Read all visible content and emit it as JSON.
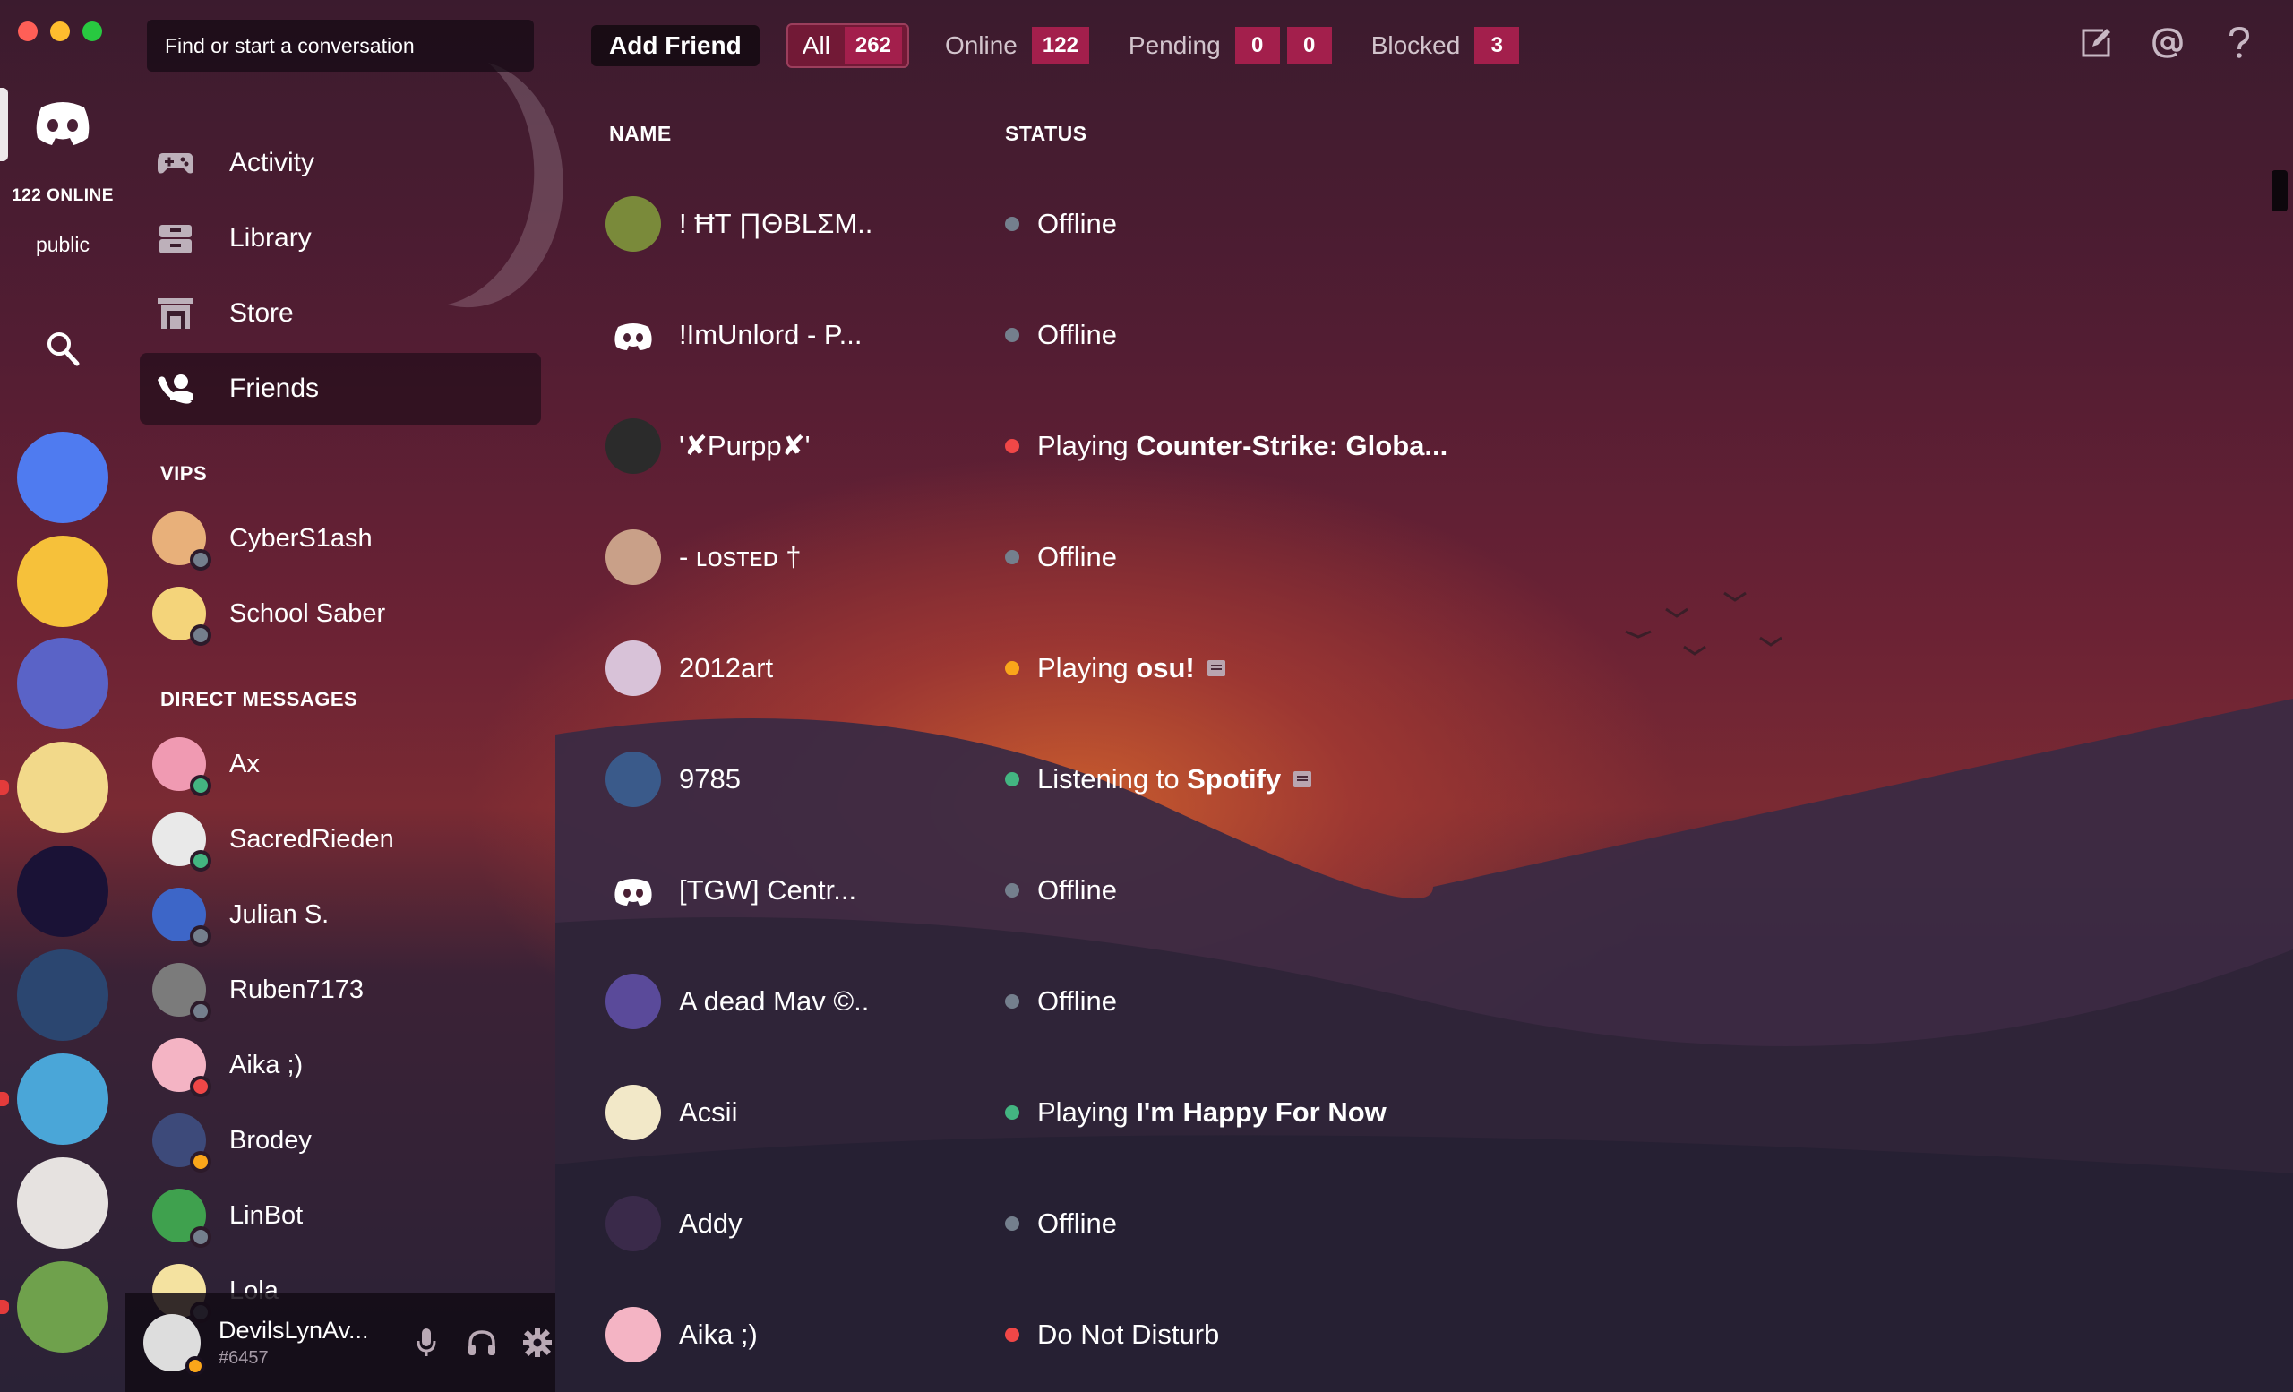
{
  "window": {
    "traffic_lights": {
      "close": "#ff5f57",
      "minimize": "#ffbd2e",
      "maximize": "#28c940"
    }
  },
  "servers": {
    "online_count": "122 ONLINE",
    "public_label": "public",
    "items": [
      {
        "name": "server-2",
        "color": "#4f7bf0",
        "unread": false
      },
      {
        "name": "server-crying-emoji",
        "color": "#f6c13a",
        "unread": false
      },
      {
        "name": "server-egg",
        "color": "#5a63c7",
        "unread": false
      },
      {
        "name": "server-anime-blonde",
        "color": "#f2d98a",
        "unread": true
      },
      {
        "name": "server-g-logo",
        "color": "#1a1236",
        "unread": false
      },
      {
        "name": "server-house",
        "color": "#2b4670",
        "unread": false
      },
      {
        "name": "server-earth",
        "color": "#4aa6d8",
        "unread": true
      },
      {
        "name": "server-white-hair",
        "color": "#e6e2e0",
        "unread": false
      },
      {
        "name": "server-witch",
        "color": "#6fa14c",
        "unread": true
      }
    ]
  },
  "channels": {
    "search_placeholder": "Find or start a conversation",
    "nav": [
      {
        "key": "activity",
        "label": "Activity",
        "icon": "gamepad-icon",
        "active": false
      },
      {
        "key": "library",
        "label": "Library",
        "icon": "library-icon",
        "active": false
      },
      {
        "key": "store",
        "label": "Store",
        "icon": "store-icon",
        "active": false
      },
      {
        "key": "friends",
        "label": "Friends",
        "icon": "friends-icon",
        "active": true
      }
    ],
    "vips_heading": "VIPS",
    "vips": [
      {
        "name": "CyberS1ash",
        "avatar_color": "#e8b07a",
        "presence": "#747f8d"
      },
      {
        "name": "School Saber",
        "avatar_color": "#f4d47a",
        "presence": "#747f8d"
      }
    ],
    "dm_heading": "DIRECT MESSAGES",
    "dms": [
      {
        "name": "Ax",
        "avatar_color": "#f09ab2",
        "presence": "#43b581"
      },
      {
        "name": "SacredRieden",
        "avatar_color": "#e9e9e9",
        "presence": "#43b581"
      },
      {
        "name": "Julian S.",
        "avatar_color": "#3d66c8",
        "presence": "#747f8d"
      },
      {
        "name": "Ruben7173",
        "avatar_color": "#7b7b7b",
        "presence": "#747f8d"
      },
      {
        "name": "Aika ;)",
        "avatar_color": "#f4b4c4",
        "presence": "#f04747"
      },
      {
        "name": "Brodey",
        "avatar_color": "#3d4a7a",
        "presence": "#faa61a"
      },
      {
        "name": "LinBot",
        "avatar_color": "#3fa14e",
        "presence": "#747f8d"
      },
      {
        "name": "Lola",
        "avatar_color": "#f4e2a0",
        "presence": "#747f8d"
      }
    ]
  },
  "user": {
    "name": "DevilsLynAv...",
    "discriminator": "#6457",
    "presence": "#faa61a"
  },
  "topbar": {
    "add_friend": "Add Friend",
    "tabs": [
      {
        "label": "All",
        "badges": [
          "262"
        ],
        "active": true
      },
      {
        "label": "Online",
        "badges": [
          "122"
        ],
        "active": false
      },
      {
        "label": "Pending",
        "badges": [
          "0",
          "0"
        ],
        "active": false
      },
      {
        "label": "Blocked",
        "badges": [
          "3"
        ],
        "active": false
      }
    ]
  },
  "friends": {
    "columns": {
      "name": "NAME",
      "status": "STATUS"
    },
    "rows": [
      {
        "name": "! ĦT ∏ΘBLΣM..",
        "avatar_color": "#7a8a3a",
        "status_color": "#747f8d",
        "status_prefix": "Offline",
        "status_bold": "",
        "rich": false
      },
      {
        "name": "!ImUnlord - P...",
        "avatar_color": "transparent",
        "status_color": "#747f8d",
        "status_prefix": "Offline",
        "status_bold": "",
        "rich": false
      },
      {
        "name": "'✘Purpp✘'",
        "avatar_color": "#2b2b2b",
        "status_color": "#f04747",
        "status_prefix": "Playing ",
        "status_bold": "Counter-Strike: Globa...",
        "rich": false
      },
      {
        "name": "- ʟᴏsᴛᴇᴅ †",
        "avatar_color": "#c9a088",
        "status_color": "#747f8d",
        "status_prefix": "Offline",
        "status_bold": "",
        "rich": false
      },
      {
        "name": "2012art",
        "avatar_color": "#d8c2d8",
        "status_color": "#faa61a",
        "status_prefix": "Playing ",
        "status_bold": "osu!",
        "rich": true
      },
      {
        "name": "9785",
        "avatar_color": "#3a5a8a",
        "status_color": "#43b581",
        "status_prefix": "Listening to ",
        "status_bold": "Spotify",
        "rich": true
      },
      {
        "name": "[TGW] Centr...",
        "avatar_color": "transparent",
        "status_color": "#747f8d",
        "status_prefix": "Offline",
        "status_bold": "",
        "rich": false
      },
      {
        "name": "A dead Mav ©..",
        "avatar_color": "#5a4a9a",
        "status_color": "#747f8d",
        "status_prefix": "Offline",
        "status_bold": "",
        "rich": false
      },
      {
        "name": "Acsii",
        "avatar_color": "#f2e8c8",
        "status_color": "#43b581",
        "status_prefix": "Playing ",
        "status_bold": "I'm Happy For Now",
        "rich": false
      },
      {
        "name": "Addy",
        "avatar_color": "#3a2a4a",
        "status_color": "#747f8d",
        "status_prefix": "Offline",
        "status_bold": "",
        "rich": false
      },
      {
        "name": "Aika ;)",
        "avatar_color": "#f4b4c4",
        "status_color": "#f04747",
        "status_prefix": "Do Not Disturb",
        "status_bold": "",
        "rich": false
      }
    ]
  },
  "top_icons": [
    "new-dm-icon",
    "mention-icon",
    "help-icon"
  ]
}
